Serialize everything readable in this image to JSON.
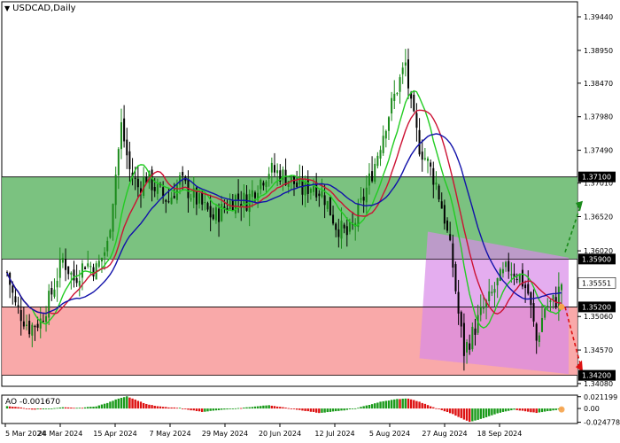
{
  "window": {
    "symbol_label": "USDCAD,Daily",
    "dropdown_icon": "triangle-down-icon"
  },
  "colors": {
    "background": "#ffffff",
    "bull_candle": "#1a8a1a",
    "bear_candle": "#000000",
    "resistance_zone": "#6dbb72",
    "support_zone": "#f8a0a0",
    "forecast_channel": "#d98ae8",
    "ma_fast": "#22cc22",
    "ma_mid": "#cc1133",
    "ma_slow": "#1111aa",
    "ao_up": "#1a9a1a",
    "ao_down": "#dd1111",
    "price_tag_dark": "#000000",
    "arrow_up": "#1a8a1a",
    "arrow_down": "#dd1111"
  },
  "chart_data": [
    {
      "type": "candlestick",
      "symbol": "USDCAD",
      "timeframe": "Daily",
      "x_tick_labels": [
        "5 Mar 2024",
        "24 Mar 2024",
        "15 Apr 2024",
        "7 May 2024",
        "29 May 2024",
        "20 Jun 2024",
        "12 Jul 2024",
        "5 Aug 2024",
        "27 Aug 2024",
        "18 Sep 2024"
      ],
      "y_tick_labels": [
        "1.39440",
        "1.38950",
        "1.38470",
        "1.37980",
        "1.37490",
        "1.37010",
        "1.36520",
        "1.36020",
        "1.35060",
        "1.34570",
        "1.34080"
      ],
      "ylim": [
        1.3404,
        1.3966
      ],
      "levels": [
        {
          "label": "1.37100",
          "value": 1.371
        },
        {
          "label": "1.35900",
          "value": 1.359
        },
        {
          "label": "1.35200",
          "value": 1.352
        },
        {
          "label": "1.34200",
          "value": 1.342
        }
      ],
      "last_price_label": "1.35551",
      "last_price": 1.35551,
      "zones": [
        {
          "name": "resistance",
          "from": 1.359,
          "to": 1.371
        },
        {
          "name": "support",
          "from": 1.342,
          "to": 1.352
        }
      ],
      "close_path": [
        [
          0,
          1.357
        ],
        [
          3,
          1.3522
        ],
        [
          8,
          1.349
        ],
        [
          12,
          1.35
        ],
        [
          16,
          1.354
        ],
        [
          20,
          1.359
        ],
        [
          24,
          1.356
        ],
        [
          28,
          1.3585
        ],
        [
          32,
          1.3575
        ],
        [
          36,
          1.361
        ],
        [
          38,
          1.368
        ],
        [
          41,
          1.3785
        ],
        [
          44,
          1.372
        ],
        [
          47,
          1.3695
        ],
        [
          50,
          1.371
        ],
        [
          54,
          1.369
        ],
        [
          58,
          1.3675
        ],
        [
          62,
          1.3705
        ],
        [
          66,
          1.3685
        ],
        [
          70,
          1.3668
        ],
        [
          74,
          1.365
        ],
        [
          78,
          1.3665
        ],
        [
          82,
          1.368
        ],
        [
          86,
          1.3675
        ],
        [
          90,
          1.37
        ],
        [
          94,
          1.372
        ],
        [
          98,
          1.3715
        ],
        [
          102,
          1.3705
        ],
        [
          106,
          1.369
        ],
        [
          110,
          1.37
        ],
        [
          114,
          1.368
        ],
        [
          118,
          1.364
        ],
        [
          122,
          1.3625
        ],
        [
          124,
          1.3635
        ],
        [
          128,
          1.368
        ],
        [
          132,
          1.373
        ],
        [
          136,
          1.379
        ],
        [
          140,
          1.384
        ],
        [
          143,
          1.3875
        ],
        [
          145,
          1.381
        ],
        [
          148,
          1.3755
        ],
        [
          151,
          1.373
        ],
        [
          154,
          1.37
        ],
        [
          157,
          1.365
        ],
        [
          160,
          1.358
        ],
        [
          162,
          1.351
        ],
        [
          164,
          1.3455
        ],
        [
          167,
          1.348
        ],
        [
          170,
          1.351
        ],
        [
          173,
          1.353
        ],
        [
          176,
          1.3555
        ],
        [
          180,
          1.3578
        ],
        [
          184,
          1.3565
        ],
        [
          187,
          1.354
        ],
        [
          190,
          1.347
        ],
        [
          193,
          1.352
        ],
        [
          197,
          1.353
        ],
        [
          199,
          1.3555
        ]
      ],
      "moving_averages": [
        {
          "name": "fast",
          "color": "#22cc22",
          "period": 5
        },
        {
          "name": "mid",
          "color": "#cc1133",
          "period": 8
        },
        {
          "name": "slow",
          "color": "#1111aa",
          "period": 13
        }
      ]
    },
    {
      "type": "bar",
      "indicator": "AO",
      "label": "AO -0.001670",
      "y_tick_labels": [
        "0.021199",
        "0.00",
        "-0.024778"
      ],
      "ylim": [
        -0.027,
        0.024
      ],
      "value_path": [
        [
          0,
          0.004
        ],
        [
          5,
          0.002
        ],
        [
          9,
          -0.002
        ],
        [
          14,
          -0.001
        ],
        [
          20,
          0.002
        ],
        [
          26,
          0.001
        ],
        [
          32,
          0.004
        ],
        [
          36,
          0.01
        ],
        [
          40,
          0.018
        ],
        [
          43,
          0.022
        ],
        [
          46,
          0.016
        ],
        [
          50,
          0.008
        ],
        [
          54,
          0.004
        ],
        [
          58,
          0.002
        ],
        [
          62,
          0.001
        ],
        [
          66,
          -0.003
        ],
        [
          70,
          -0.006
        ],
        [
          74,
          -0.004
        ],
        [
          78,
          -0.002
        ],
        [
          84,
          0.001
        ],
        [
          90,
          0.004
        ],
        [
          94,
          0.006
        ],
        [
          98,
          0.003
        ],
        [
          104,
          -0.002
        ],
        [
          108,
          -0.005
        ],
        [
          112,
          -0.008
        ],
        [
          116,
          -0.006
        ],
        [
          120,
          -0.004
        ],
        [
          124,
          -0.001
        ],
        [
          128,
          0.004
        ],
        [
          134,
          0.012
        ],
        [
          140,
          0.017
        ],
        [
          144,
          0.018
        ],
        [
          148,
          0.012
        ],
        [
          152,
          0.004
        ],
        [
          156,
          -0.003
        ],
        [
          160,
          -0.01
        ],
        [
          164,
          -0.02
        ],
        [
          166,
          -0.024
        ],
        [
          170,
          -0.019
        ],
        [
          174,
          -0.012
        ],
        [
          178,
          -0.006
        ],
        [
          182,
          -0.002
        ],
        [
          186,
          -0.005
        ],
        [
          190,
          -0.008
        ],
        [
          194,
          -0.005
        ],
        [
          198,
          -0.002
        ],
        [
          199,
          -0.0017
        ]
      ]
    }
  ]
}
